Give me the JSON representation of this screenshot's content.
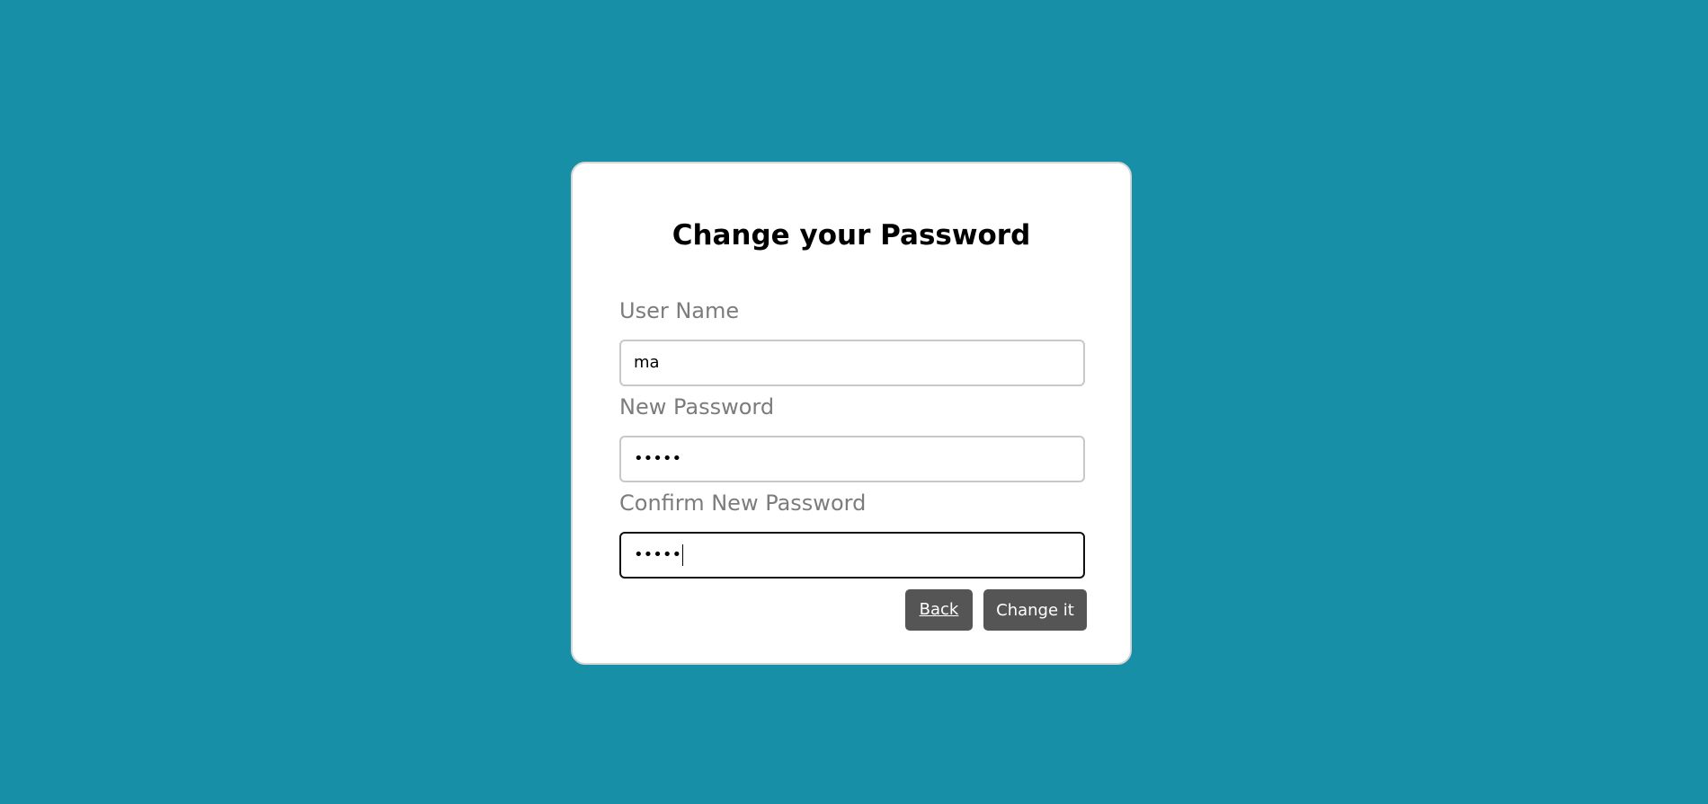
{
  "form": {
    "title": "Change your Password",
    "username_label": "User Name",
    "username_value": "ma",
    "new_password_label": "New Password",
    "new_password_value": "•••••",
    "confirm_password_label": "Confirm New Password",
    "confirm_password_value": "•••••",
    "back_label": "Back",
    "submit_label": "Change it"
  },
  "colors": {
    "background": "#178fa6",
    "card": "#ffffff",
    "button": "#555555",
    "label": "#7c7c7c"
  }
}
